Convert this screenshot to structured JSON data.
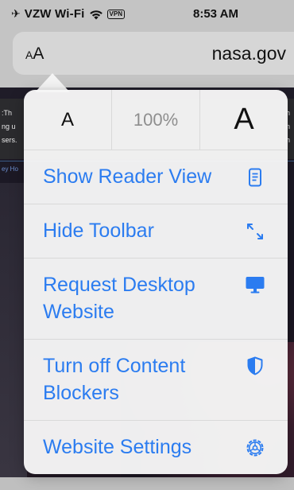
{
  "status_bar": {
    "carrier": "VZW Wi-Fi",
    "vpn": "VPN",
    "time": "8:53 AM"
  },
  "address_bar": {
    "aa_small": "A",
    "aa_large": "A",
    "domain": "nasa.gov"
  },
  "background": {
    "left_lines": [
      ":Th",
      "ng u",
      "sers."
    ],
    "left_blue": "ey Ho",
    "right_lines": [
      "h",
      "n",
      "h"
    ]
  },
  "popover": {
    "font_smaller": "A",
    "zoom": "100%",
    "font_larger": "A",
    "items": [
      {
        "label": "Show Reader View",
        "icon": "reader-view-icon"
      },
      {
        "label": "Hide Toolbar",
        "icon": "resize-arrows-icon"
      },
      {
        "label": "Request Desktop\nWebsite",
        "icon": "desktop-monitor-icon"
      },
      {
        "label": "Turn off Content\nBlockers",
        "icon": "shield-icon"
      },
      {
        "label": "Website Settings",
        "icon": "gear-icon"
      }
    ]
  },
  "colors": {
    "accent": "#2b7cf0",
    "popover_bg": "#f6f6f6",
    "zoom_text": "#8e8e8e"
  }
}
